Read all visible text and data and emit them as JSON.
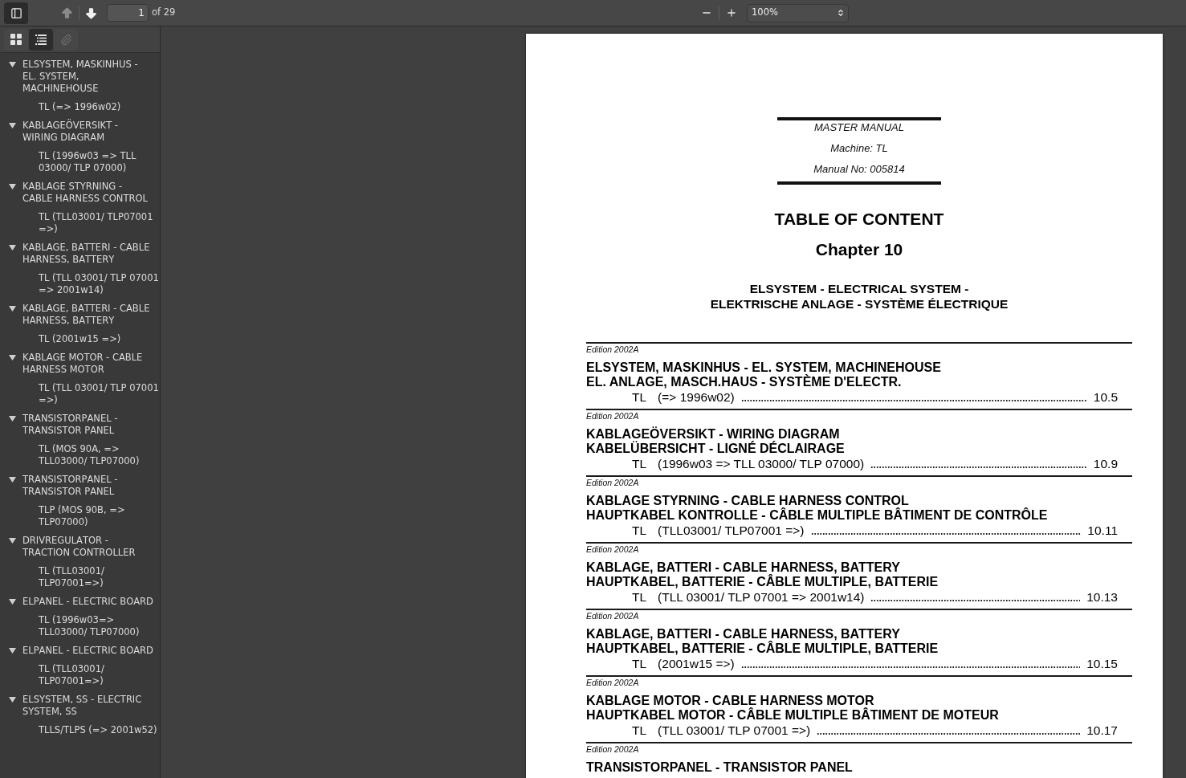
{
  "toolbar": {
    "sidebar_open": true,
    "nav": [
      {
        "kind": "previous",
        "disabled": true
      },
      {
        "kind": "next",
        "disabled": false
      }
    ],
    "page_number": "1",
    "page_count": "of 29",
    "zoom_buttons": [
      {
        "kind": "zoom_out"
      },
      {
        "kind": "zoom_in"
      }
    ],
    "zoom": "100%"
  },
  "sidebar": {
    "tabs": [
      {
        "kind": "thumbnails",
        "selected": false,
        "disabled": false
      },
      {
        "kind": "outline",
        "selected": true,
        "disabled": false
      },
      {
        "kind": "attachments",
        "selected": false,
        "disabled": true
      }
    ],
    "outline": [
      {
        "title": "ELSYSTEM, MASKINHUS - EL. SYSTEM, MACHINEHOUSE",
        "expanded": true,
        "children": [
          {
            "title": "TL (=> 1996w02)"
          }
        ]
      },
      {
        "title": "KABLAGEÖVERSIKT - WIRING DIAGRAM",
        "expanded": true,
        "children": [
          {
            "title": "TL (1996w03 => TLL 03000/ TLP 07000)"
          }
        ]
      },
      {
        "title": "KABLAGE STYRNING - CABLE HARNESS CONTROL",
        "expanded": true,
        "children": [
          {
            "title": "TL (TLL03001/ TLP07001 =>)"
          }
        ]
      },
      {
        "title": "KABLAGE, BATTERI - CABLE HARNESS, BATTERY",
        "expanded": true,
        "children": [
          {
            "title": "TL (TLL 03001/ TLP 07001 => 2001w14)"
          }
        ]
      },
      {
        "title": "KABLAGE, BATTERI - CABLE HARNESS, BATTERY",
        "expanded": true,
        "children": [
          {
            "title": "TL (2001w15 =>)"
          }
        ]
      },
      {
        "title": "KABLAGE MOTOR - CABLE HARNESS MOTOR",
        "expanded": true,
        "children": [
          {
            "title": "TL (TLL 03001/ TLP 07001 =>)"
          }
        ]
      },
      {
        "title": "TRANSISTORPANEL - TRANSISTOR PANEL",
        "expanded": true,
        "children": [
          {
            "title": "TL (MOS 90A, => TLL03000/ TLP07000)"
          }
        ]
      },
      {
        "title": "TRANSISTORPANEL - TRANSISTOR PANEL",
        "expanded": true,
        "children": [
          {
            "title": "TLP (MOS 90B, => TLP07000)"
          }
        ]
      },
      {
        "title": "DRIVREGULATOR - TRACTION CONTROLLER",
        "expanded": true,
        "children": [
          {
            "title": "TL (TLL03001/ TLP07001=>)"
          }
        ]
      },
      {
        "title": "ELPANEL - ELECTRIC BOARD",
        "expanded": true,
        "children": [
          {
            "title": "TL (1996w03=> TLL03000/ TLP07000)"
          }
        ]
      },
      {
        "title": "ELPANEL - ELECTRIC BOARD",
        "expanded": true,
        "children": [
          {
            "title": "TL (TLL03001/ TLP07001=>)"
          }
        ]
      },
      {
        "title": "ELSYSTEM, SS - ELECTRIC SYSTEM, SS",
        "expanded": true,
        "children": [
          {
            "title": "TLLS/TLPS (=> 2001w52)"
          }
        ]
      }
    ]
  },
  "page": {
    "header_lines": [
      "MASTER MANUAL",
      "Machine: TL",
      "Manual No: 005814"
    ],
    "title": "TABLE OF CONTENT",
    "chapter": "Chapter 10",
    "subtitle_lines": [
      "ELSYSTEM - ELECTRICAL SYSTEM -",
      "ELEKTRISCHE ANLAGE - SYSTÈME ÉLECTRIQUE"
    ],
    "entries": [
      {
        "edition": "Edition 2002A",
        "titles": [
          "ELSYSTEM, MASKINHUS - EL. SYSTEM, MACHINEHOUSE",
          "EL. ANLAGE, MASCH.HAUS - SYSTÈME D'ELECTR."
        ],
        "model": "TL",
        "range": "(=> 1996w02)",
        "page": "10.5"
      },
      {
        "edition": "Edition 2002A",
        "titles": [
          "KABLAGEÖVERSIKT - WIRING DIAGRAM",
          "KABELÜBERSICHT - LIGNÉ DÉCLAIRAGE"
        ],
        "model": "TL",
        "range": "(1996w03 => TLL 03000/ TLP 07000)",
        "page": "10.9"
      },
      {
        "edition": "Edition 2002A",
        "titles": [
          "KABLAGE STYRNING - CABLE HARNESS CONTROL",
          "HAUPTKABEL KONTROLLE - CÂBLE MULTIPLE BÂTIMENT DE CONTRÔLE"
        ],
        "model": "TL",
        "range": "(TLL03001/ TLP07001 =>)",
        "page": "10.11"
      },
      {
        "edition": "Edition 2002A",
        "titles": [
          "KABLAGE, BATTERI - CABLE HARNESS, BATTERY",
          "HAUPTKABEL, BATTERIE - CÂBLE MULTIPLE, BATTERIE"
        ],
        "model": "TL",
        "range": "(TLL 03001/ TLP 07001 => 2001w14)",
        "page": "10.13"
      },
      {
        "edition": "Edition 2002A",
        "titles": [
          "KABLAGE, BATTERI - CABLE HARNESS, BATTERY",
          "HAUPTKABEL, BATTERIE - CÂBLE MULTIPLE, BATTERIE"
        ],
        "model": "TL",
        "range": "(2001w15 =>)",
        "page": "10.15"
      },
      {
        "edition": "Edition 2002A",
        "titles": [
          "KABLAGE MOTOR - CABLE HARNESS MOTOR",
          "HAUPTKABEL MOTOR - CÂBLE MULTIPLE BÂTIMENT DE MOTEUR"
        ],
        "model": "TL",
        "range": "(TLL 03001/ TLP 07001 =>)",
        "page": "10.17"
      },
      {
        "edition": "Edition 2002A",
        "titles": [
          "TRANSISTORPANEL - TRANSISTOR PANEL"
        ]
      }
    ]
  }
}
